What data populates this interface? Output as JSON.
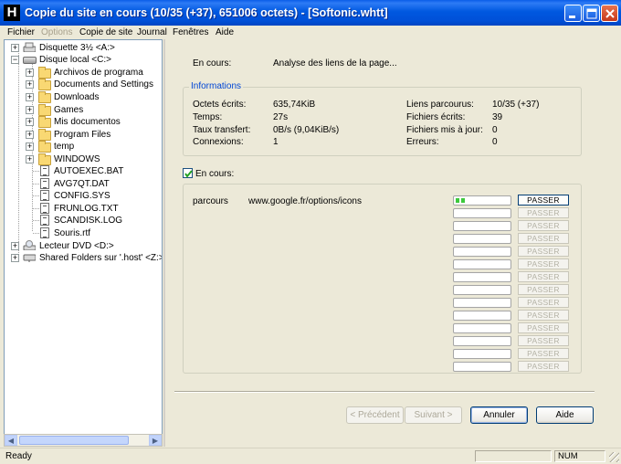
{
  "window": {
    "title": "Copie du site en cours (10/35 (+37), 651006 octets) - [Softonic.whtt]",
    "app_icon_letter": "H"
  },
  "menu": [
    "Fichier",
    "Options",
    "Copie de site",
    "Journal",
    "Fenêtres",
    "Aide"
  ],
  "tree": {
    "items": [
      {
        "label": "Disquette 3½ <A:>",
        "icon": "floppy-drive-icon"
      },
      {
        "label": "Disque local <C:>",
        "icon": "hard-drive-icon"
      },
      {
        "label": "Archivos de programa",
        "icon": "folder-icon"
      },
      {
        "label": "Documents and Settings",
        "icon": "folder-icon"
      },
      {
        "label": "Downloads",
        "icon": "folder-icon"
      },
      {
        "label": "Games",
        "icon": "folder-icon"
      },
      {
        "label": "Mis documentos",
        "icon": "folder-icon"
      },
      {
        "label": "Program Files",
        "icon": "folder-icon"
      },
      {
        "label": "temp",
        "icon": "folder-icon"
      },
      {
        "label": "WINDOWS",
        "icon": "folder-icon"
      },
      {
        "label": "AUTOEXEC.BAT",
        "icon": "file-icon"
      },
      {
        "label": "AVG7QT.DAT",
        "icon": "file-icon"
      },
      {
        "label": "CONFIG.SYS",
        "icon": "file-icon"
      },
      {
        "label": "FRUNLOG.TXT",
        "icon": "file-icon"
      },
      {
        "label": "SCANDISK.LOG",
        "icon": "file-icon"
      },
      {
        "label": "Souris.rtf",
        "icon": "file-icon"
      },
      {
        "label": "Lecteur DVD <D:>",
        "icon": "dvd-drive-icon"
      },
      {
        "label": "Shared Folders sur '.host' <Z:>",
        "icon": "network-drive-icon"
      }
    ]
  },
  "main": {
    "status_label": "En cours:",
    "status_value": "Analyse des liens de la page...",
    "info": {
      "title": "Informations",
      "left": [
        {
          "label": "Octets écrits:",
          "value": "635,74KiB"
        },
        {
          "label": "Temps:",
          "value": "27s"
        },
        {
          "label": "Taux transfert:",
          "value": "0B/s (9,04KiB/s)"
        },
        {
          "label": "Connexions:",
          "value": "1"
        }
      ],
      "right": [
        {
          "label": "Liens parcourus:",
          "value": "10/35 (+37)"
        },
        {
          "label": "Fichiers écrits:",
          "value": "39"
        },
        {
          "label": "Fichiers mis à jour:",
          "value": "0"
        },
        {
          "label": "Erreurs:",
          "value": "0"
        }
      ]
    },
    "in_progress_label": "En cours:",
    "in_progress_checked": true,
    "transfers": {
      "first_action": "parcours",
      "first_url": "www.google.fr/options/icons",
      "first_progress": 0.2,
      "skip_label": "PASSER",
      "row_count": 14
    },
    "buttons": {
      "previous": "< Précédent",
      "next": "Suivant >",
      "cancel": "Annuler",
      "help": "Aide"
    }
  },
  "statusbar": {
    "text": "Ready",
    "indicator": "NUM"
  }
}
